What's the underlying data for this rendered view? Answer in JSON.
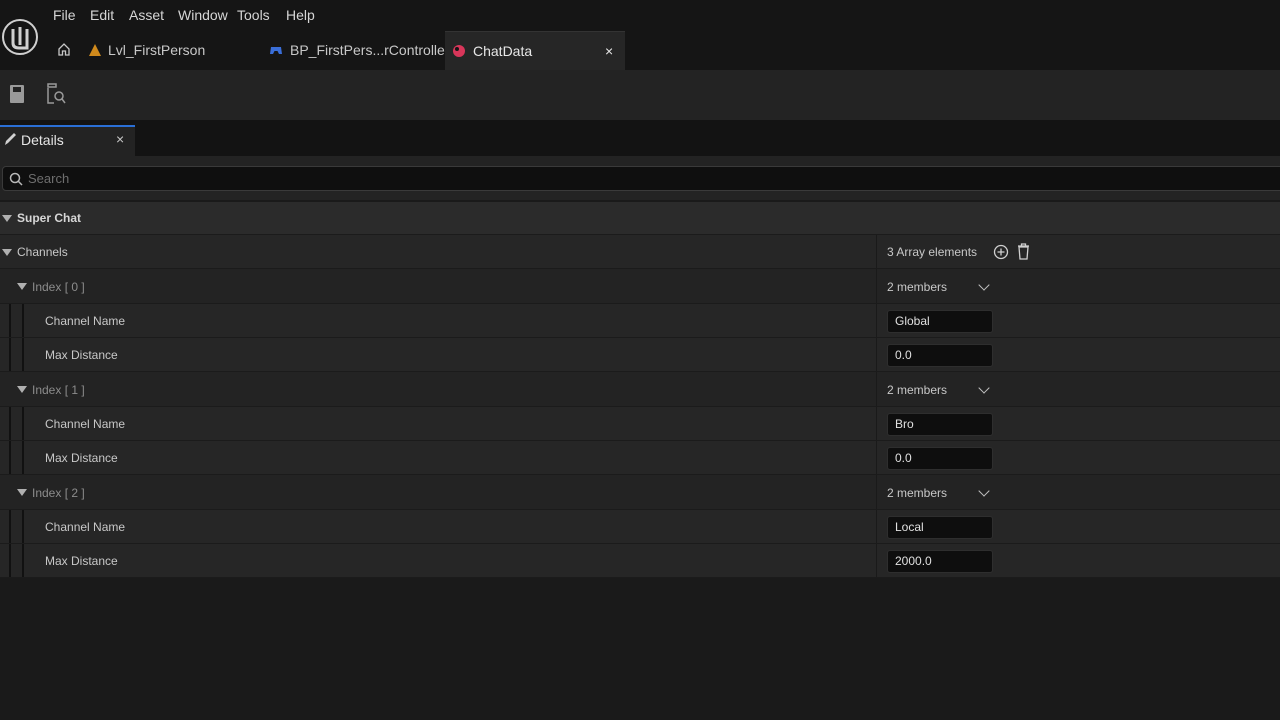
{
  "menu": [
    "File",
    "Edit",
    "Asset",
    "Window",
    "Tools",
    "Help"
  ],
  "tabs": [
    {
      "label": "Lvl_FirstPerson",
      "icon": "level-icon",
      "color": "#d08a1c"
    },
    {
      "label": "BP_FirstPers...rController",
      "icon": "blueprint-controller-icon",
      "color": "#3a6ed8"
    },
    {
      "label": "ChatData",
      "icon": "data-asset-icon",
      "color": "#d8365a",
      "close": "×"
    }
  ],
  "details": {
    "tab_label": "Details",
    "close": "×",
    "search_placeholder": "Search"
  },
  "category": "Super Chat",
  "channels": {
    "label": "Channels",
    "summary": "3 Array elements",
    "items": [
      {
        "index_label": "Index [ 0 ]",
        "members": "2 members",
        "name_label": "Channel Name",
        "name_value": "Global",
        "dist_label": "Max Distance",
        "dist_value": "0.0"
      },
      {
        "index_label": "Index [ 1 ]",
        "members": "2 members",
        "name_label": "Channel Name",
        "name_value": "Bro",
        "dist_label": "Max Distance",
        "dist_value": "0.0"
      },
      {
        "index_label": "Index [ 2 ]",
        "members": "2 members",
        "name_label": "Channel Name",
        "name_value": "Local",
        "dist_label": "Max Distance",
        "dist_value": "2000.0"
      }
    ]
  }
}
